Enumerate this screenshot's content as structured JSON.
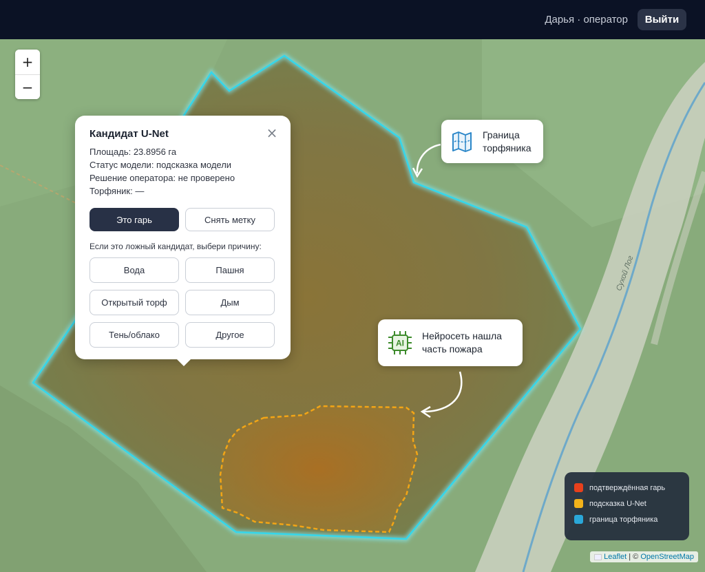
{
  "header": {
    "user_label": "Дарья · оператор",
    "logout_label": "Выйти"
  },
  "zoom": {
    "zoom_in": "+",
    "zoom_out": "−"
  },
  "popup": {
    "title": "Кандидат U-Net",
    "close": "×",
    "area_line": "Площадь: 23.8956 га",
    "status_line": "Статус модели: подсказка модели",
    "decision_line": "Решение оператора: не проверено",
    "peatland_line": "Торфяник: —",
    "confirm_label": "Это гарь",
    "remove_label": "Снять метку",
    "reason_prompt": "Если это ложный кандидат, выбери причину:",
    "reasons": [
      "Вода",
      "Пашня",
      "Открытый торф",
      "Дым",
      "Тень/облако",
      "Другое"
    ]
  },
  "callouts": {
    "boundary_line1": "Граница",
    "boundary_line2": "торфяника",
    "ai_line1": "Нейросеть нашла",
    "ai_line2": "часть пожара",
    "ai_icon_text": "AI"
  },
  "map": {
    "river_label": "Сухой Лог"
  },
  "legend": {
    "items": [
      {
        "label": "подтверждённая гарь",
        "color": "#e8401c"
      },
      {
        "label": "подсказка U-Net",
        "color": "#f2b21a"
      },
      {
        "label": "граница торфяника",
        "color": "#2aa7d8"
      }
    ]
  },
  "attribution": {
    "leaflet": "Leaflet",
    "separator": "| ©",
    "osm": "OpenStreetMap"
  },
  "colors": {
    "boundary": "#35d6ea",
    "candidate": "#f2a516",
    "topbar": "#0b1225"
  }
}
